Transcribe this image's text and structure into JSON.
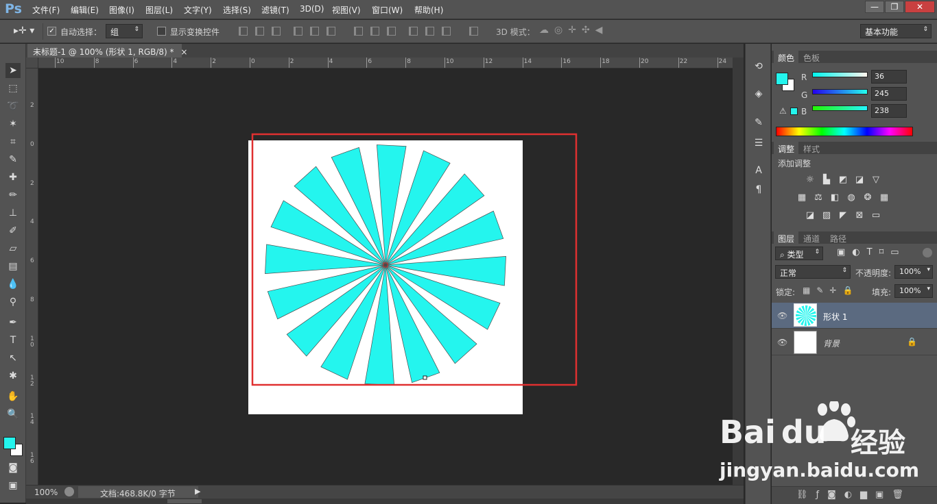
{
  "app": {
    "logo": "Ps"
  },
  "menu": [
    "文件(F)",
    "编辑(E)",
    "图像(I)",
    "图层(L)",
    "文字(Y)",
    "选择(S)",
    "滤镜(T)",
    "3D(D)",
    "视图(V)",
    "窗口(W)",
    "帮助(H)"
  ],
  "window_controls": {
    "minimize": "—",
    "restore": "❐",
    "close": "✕"
  },
  "options": {
    "auto_select_label": "自动选择：",
    "auto_select_value": "组",
    "show_transform_label": "显示变换控件",
    "mode_3d_label": "3D 模式：",
    "workspace": "基本功能"
  },
  "document": {
    "tab_title": "未标题-1 @ 100% (形状 1, RGB/8) *",
    "tab_close": "×",
    "zoom": "100%",
    "doc_info": "文档:468.8K/0 字节"
  },
  "ruler": {
    "h": [
      "10",
      "8",
      "6",
      "4",
      "2",
      "0",
      "2",
      "4",
      "6",
      "8",
      "10",
      "12",
      "14",
      "16",
      "18",
      "20",
      "22",
      "24"
    ],
    "v": [
      "2",
      "0",
      "2",
      "4",
      "6",
      "8",
      "1\n0",
      "1\n2",
      "1\n4",
      "1\n6"
    ]
  },
  "canvas": {
    "spokes": 16,
    "fill_color": "#24F5EE",
    "background_color": "#FFFFFF",
    "highlight_color": "#E03030"
  },
  "color_panel": {
    "tabs": [
      "颜色",
      "色板"
    ],
    "r_label": "R",
    "g_label": "G",
    "b_label": "B",
    "r": "36",
    "g": "245",
    "b": "238",
    "fg": "#24F5EE",
    "bg": "#FFFFFF"
  },
  "adjust_panel": {
    "tabs": [
      "调整",
      "样式"
    ],
    "title": "添加调整",
    "icons": [
      [
        "brightness-icon",
        "levels-icon",
        "curves-icon",
        "exposure-icon",
        "vibrance-icon"
      ],
      [
        "hue-saturation-icon",
        "color-balance-icon",
        "black-white-icon",
        "photo-filter-icon",
        "channel-mixer-icon",
        "color-lookup-icon"
      ],
      [
        "invert-icon",
        "posterize-icon",
        "threshold-icon",
        "selective-color-icon",
        "gradient-map-icon"
      ]
    ]
  },
  "layers_panel": {
    "tabs": [
      "图层",
      "通道",
      "路径"
    ],
    "filter_kind": "类型",
    "blend_mode": "正常",
    "opacity_label": "不透明度:",
    "opacity": "100%",
    "lock_label": "锁定:",
    "fill_label": "填充:",
    "fill": "100%",
    "layers": [
      {
        "name": "形状 1",
        "selected": true
      },
      {
        "name": "背景",
        "selected": false,
        "locked": true
      }
    ],
    "bottom_icons": [
      "link-icon",
      "fx-icon",
      "mask-icon",
      "adjustment-icon",
      "folder-icon",
      "new-layer-icon",
      "trash-icon"
    ]
  },
  "watermark": {
    "brand": "Bai",
    "brand2": "du",
    "cn": "经验",
    "url": "jingyan.baidu.com"
  }
}
